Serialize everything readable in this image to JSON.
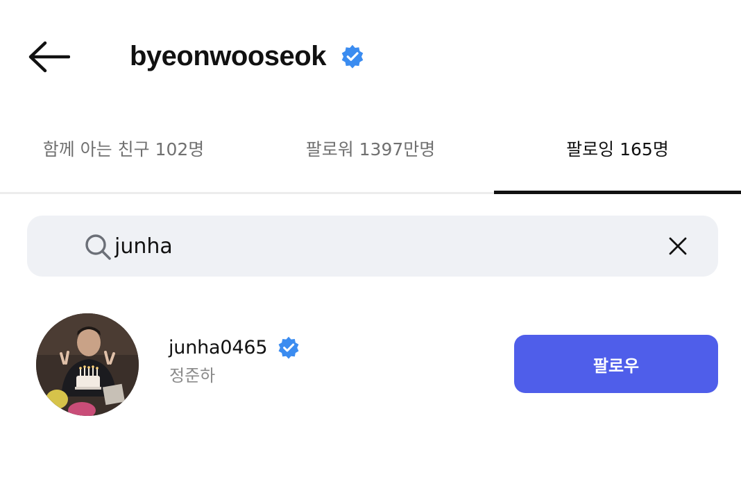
{
  "header": {
    "title": "byeonwooseok",
    "verified": true,
    "back_icon": "arrow-left-icon"
  },
  "tabs": [
    {
      "label": "함께 아는 친구 102명",
      "active": false
    },
    {
      "label": "팔로워 1397만명",
      "active": false
    },
    {
      "label": "팔로잉 165명",
      "active": true
    }
  ],
  "search": {
    "value": "junha",
    "icon": "search-icon",
    "clear_icon": "close-icon"
  },
  "results": [
    {
      "username": "junha0465",
      "full_name": "정준하",
      "verified": true,
      "button_label": "팔로우"
    }
  ],
  "colors": {
    "accent": "#4f5eea",
    "verified": "#3b8cf0",
    "search_bg": "#eff1f5"
  }
}
